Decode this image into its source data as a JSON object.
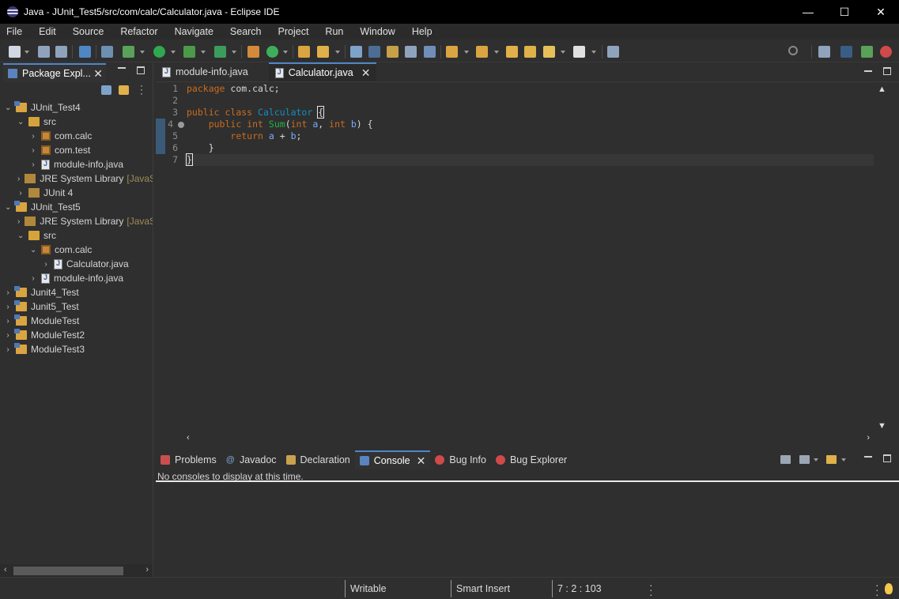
{
  "window": {
    "title": "Java - JUnit_Test5/src/com/calc/Calculator.java - Eclipse IDE",
    "controls": {
      "minimize": "—",
      "maximize": "☐",
      "close": "✕"
    }
  },
  "menu": [
    "File",
    "Edit",
    "Source",
    "Refactor",
    "Navigate",
    "Search",
    "Project",
    "Run",
    "Window",
    "Help"
  ],
  "package_explorer": {
    "tab_label": "Package Expl...",
    "tree": [
      {
        "label": "JUnit_Test4",
        "twisty": "⌄",
        "icon": "project",
        "indent": 0
      },
      {
        "label": "src",
        "twisty": "⌄",
        "icon": "src",
        "indent": 1
      },
      {
        "label": "com.calc",
        "twisty": "›",
        "icon": "package",
        "indent": 2
      },
      {
        "label": "com.test",
        "twisty": "›",
        "icon": "package",
        "indent": 2
      },
      {
        "label": "module-info.java",
        "twisty": "›",
        "icon": "java",
        "indent": 2
      },
      {
        "label": "JRE System Library",
        "decoration": "[JavaSE",
        "twisty": "›",
        "icon": "library",
        "indent": 1
      },
      {
        "label": "JUnit 4",
        "twisty": "›",
        "icon": "library",
        "indent": 1
      },
      {
        "label": "JUnit_Test5",
        "twisty": "⌄",
        "icon": "project",
        "indent": 0
      },
      {
        "label": "JRE System Library",
        "decoration": "[JavaSE",
        "twisty": "›",
        "icon": "library",
        "indent": 1
      },
      {
        "label": "src",
        "twisty": "⌄",
        "icon": "src",
        "indent": 1
      },
      {
        "label": "com.calc",
        "twisty": "⌄",
        "icon": "package",
        "indent": 2
      },
      {
        "label": "Calculator.java",
        "twisty": "›",
        "icon": "java",
        "indent": 3
      },
      {
        "label": "module-info.java",
        "twisty": "›",
        "icon": "java",
        "indent": 2
      },
      {
        "label": "Junit4_Test",
        "twisty": "›",
        "icon": "project",
        "indent": 0
      },
      {
        "label": "Junit5_Test",
        "twisty": "›",
        "icon": "project",
        "indent": 0
      },
      {
        "label": "ModuleTest",
        "twisty": "›",
        "icon": "project",
        "indent": 0
      },
      {
        "label": "ModuleTest2",
        "twisty": "›",
        "icon": "project",
        "indent": 0
      },
      {
        "label": "ModuleTest3",
        "twisty": "›",
        "icon": "project",
        "indent": 0
      }
    ]
  },
  "editor": {
    "tabs": [
      {
        "label": "module-info.java",
        "active": false
      },
      {
        "label": "Calculator.java",
        "active": true
      }
    ],
    "line_numbers": [
      "1",
      "2",
      "3",
      "4",
      "5",
      "6",
      "7"
    ],
    "code": {
      "l1_kw": "package",
      "l1_rest": " com.calc;",
      "l3_kw1": "public",
      "l3_kw2": "class",
      "l3_type": "Calculator",
      "l3_brace": "{",
      "l4_kw1": "public",
      "l4_kw2": "int",
      "l4_method": "Sum",
      "l4_open": "(",
      "l4_kw3": "int",
      "l4_p1": "a",
      "l4_comma": ", ",
      "l4_kw4": "int",
      "l4_p2": "b",
      "l4_close": ") {",
      "l5_kw": "return",
      "l5_p1": "a",
      "l5_plus": " + ",
      "l5_p2": "b",
      "l5_semi": ";",
      "l6": "}",
      "l7": "}"
    }
  },
  "bottom_panel": {
    "tabs": [
      {
        "label": "Problems",
        "active": false,
        "color": "#c94f4f"
      },
      {
        "label": "Javadoc",
        "active": false,
        "color": "#7aa7d8"
      },
      {
        "label": "Declaration",
        "active": false,
        "color": "#c9a24f"
      },
      {
        "label": "Console",
        "active": true,
        "color": "#5b83c0"
      },
      {
        "label": "Bug Info",
        "active": false,
        "color": "#d04a4a"
      },
      {
        "label": "Bug Explorer",
        "active": false,
        "color": "#d04a4a"
      }
    ],
    "console_message": "No consoles to display at this time."
  },
  "status_bar": {
    "writable": "Writable",
    "insert_mode": "Smart Insert",
    "position": "7 : 2 : 103"
  },
  "colors": {
    "accent": "#4f86c6",
    "keyword": "#cc6c1d",
    "type": "#1290c3",
    "method": "#1eb540",
    "parameter": "#79abff"
  }
}
